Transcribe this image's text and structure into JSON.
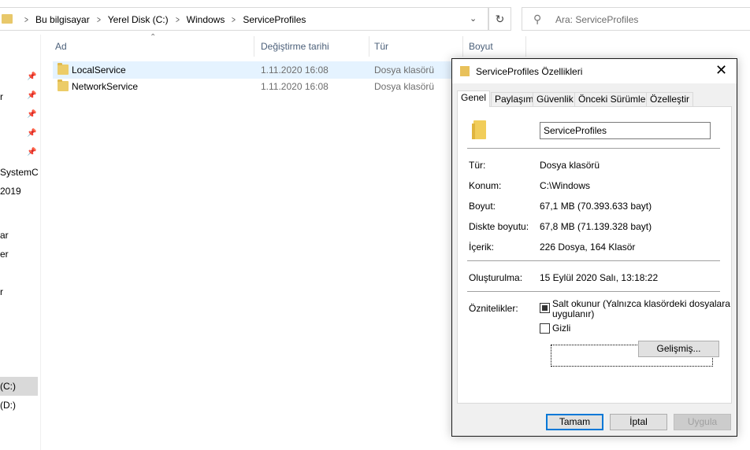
{
  "address_bar": {
    "crumbs": [
      "Bu bilgisayar",
      "Yerel Disk (C:)",
      "Windows",
      "ServiceProfiles"
    ],
    "search_placeholder": "Ara: ServiceProfiles"
  },
  "nav_pane": {
    "fragments": [
      "r",
      "SystemC",
      "2019",
      "ar",
      "er",
      "r",
      "(C:)",
      "(D:)"
    ]
  },
  "file_list": {
    "columns": [
      "Ad",
      "Değiştirme tarihi",
      "Tür",
      "Boyut"
    ],
    "rows": [
      {
        "name": "LocalService",
        "modified": "1.11.2020 16:08",
        "type": "Dosya klasörü",
        "selected": true
      },
      {
        "name": "NetworkService",
        "modified": "1.11.2020 16:08",
        "type": "Dosya klasörü",
        "selected": false
      }
    ]
  },
  "dialog": {
    "title": "ServiceProfiles Özellikleri",
    "tabs": [
      "Genel",
      "Paylaşım",
      "Güvenlik",
      "Önceki Sürümler",
      "Özelleştir"
    ],
    "active_tab": "Genel",
    "folder_name": "ServiceProfiles",
    "fields": {
      "type_label": "Tür:",
      "type_value": "Dosya klasörü",
      "location_label": "Konum:",
      "location_value": "C:\\Windows",
      "size_label": "Boyut:",
      "size_value": "67,1 MB (70.393.633 bayt)",
      "disk_size_label": "Diskte boyutu:",
      "disk_size_value": "67,8 MB (71.139.328 bayt)",
      "contains_label": "İçerik:",
      "contains_value": "226 Dosya, 164 Klasör",
      "created_label": "Oluşturulma:",
      "created_value": "15 Eylül 2020 Salı, 13:18:22",
      "attributes_label": "Öznitelikler:"
    },
    "attributes": {
      "readonly_label_line1": "Salt okunur (Yalnızca klasördeki dosyalara",
      "readonly_label_line2": "uygulanır)",
      "readonly_state": "indeterminate",
      "hidden_label": "Gizli",
      "hidden_state": "unchecked"
    },
    "buttons": {
      "advanced": "Gelişmiş...",
      "ok": "Tamam",
      "cancel": "İptal",
      "apply": "Uygula"
    },
    "close_glyph": "✕"
  }
}
